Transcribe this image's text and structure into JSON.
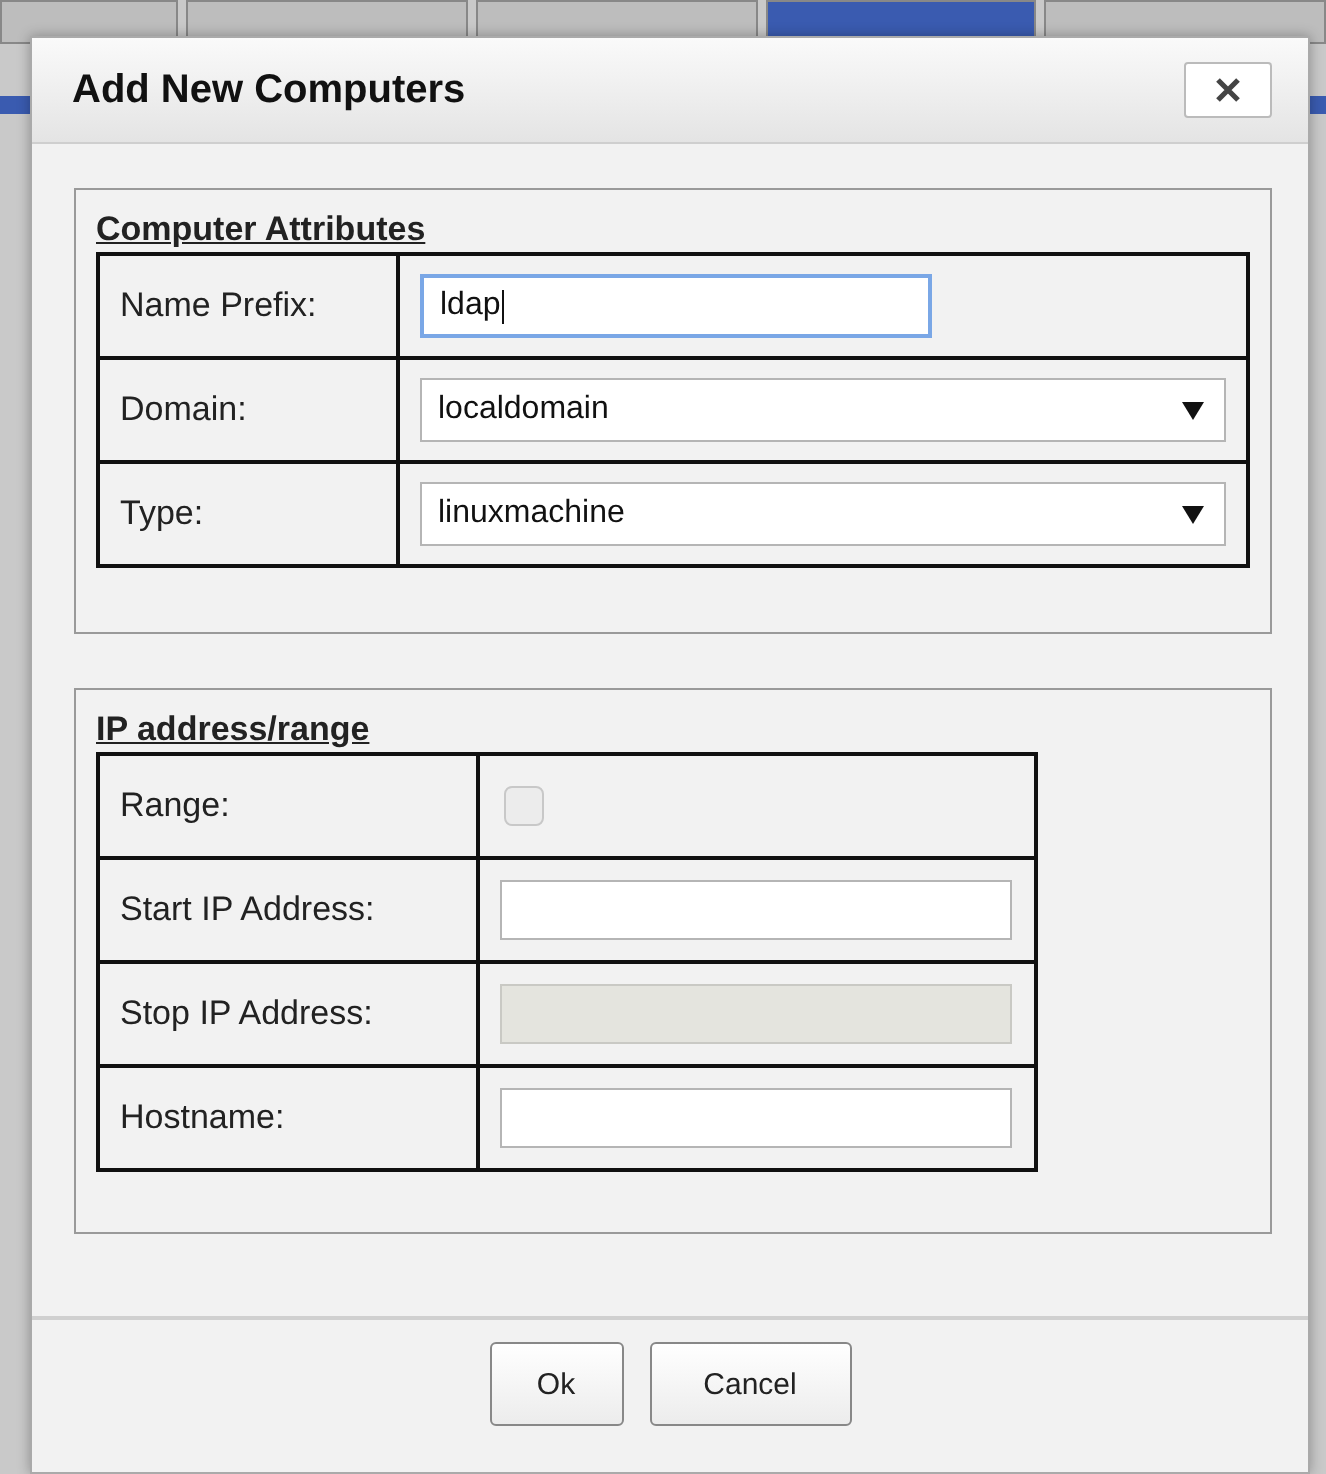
{
  "background_tabs": [
    {
      "selected": false
    },
    {
      "selected": false
    },
    {
      "selected": false
    },
    {
      "selected": true
    },
    {
      "selected": false
    }
  ],
  "dialog": {
    "title": "Add New Computers"
  },
  "sections": [
    {
      "legend": "Computer Attributes",
      "fields": [
        {
          "kind": "text",
          "label": "Name Prefix:",
          "value": "ldap",
          "focused": true,
          "disabled": false
        },
        {
          "kind": "select",
          "label": "Domain:",
          "value": "localdomain"
        },
        {
          "kind": "select",
          "label": "Type:",
          "value": "linuxmachine"
        }
      ]
    },
    {
      "legend": "IP address/range",
      "fields": [
        {
          "kind": "checkbox",
          "label": "Range:",
          "checked": false,
          "disabled": true
        },
        {
          "kind": "text",
          "label": "Start IP Address:",
          "focused": false,
          "disabled": false
        },
        {
          "kind": "text",
          "label": "Stop IP Address:",
          "focused": false,
          "disabled": true
        },
        {
          "kind": "text",
          "label": "Hostname:",
          "focused": false,
          "disabled": false
        }
      ]
    }
  ],
  "buttons": [
    "Ok",
    "Cancel"
  ]
}
